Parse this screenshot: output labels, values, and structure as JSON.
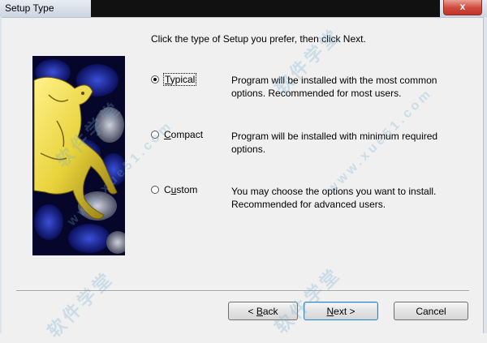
{
  "window": {
    "title": "Setup Type",
    "close_glyph": "x"
  },
  "prompt": "Click the type of Setup you prefer, then click Next.",
  "options": [
    {
      "pre": "",
      "key": "T",
      "rest": "ypical",
      "selected": true,
      "description": "Program will be installed with the most common options.  Recommended for most users."
    },
    {
      "pre": "",
      "key": "C",
      "rest": "ompact",
      "selected": false,
      "description": "Program will be installed with minimum required options."
    },
    {
      "pre": "C",
      "key": "u",
      "rest": "stom",
      "selected": false,
      "description": "You may choose the options you want to install. Recommended for advanced users."
    }
  ],
  "buttons": {
    "back": {
      "pre": "< ",
      "key": "B",
      "rest": "ack"
    },
    "next": {
      "pre": "",
      "key": "N",
      "rest": "ext >"
    },
    "cancel": "Cancel"
  },
  "watermark": {
    "text1": "软件学堂",
    "text2": "www.xue51.com"
  },
  "colors": {
    "accent": "#3c7fb1",
    "close": "#c2352a",
    "art_bg": "#05062a",
    "horse": "#e8d23a"
  }
}
